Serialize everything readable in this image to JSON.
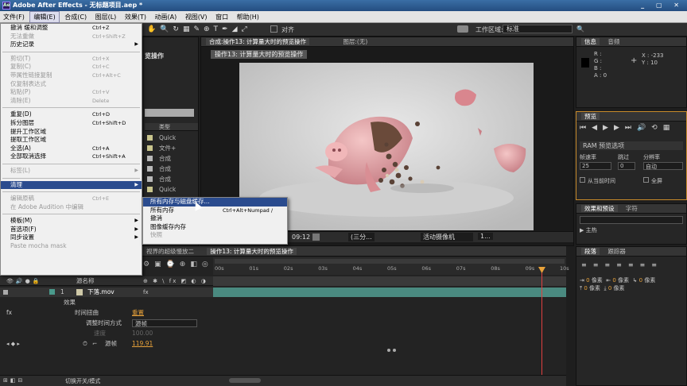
{
  "window": {
    "title": "Adobe After Effects - 无标题项目.aep *",
    "app_badge": "Ae"
  },
  "menubar": [
    "文件(F)",
    "编辑(E)",
    "合成(C)",
    "图层(L)",
    "效果(T)",
    "动画(A)",
    "视图(V)",
    "窗口",
    "帮助(H)"
  ],
  "edit_menu": [
    {
      "label": "撤消 缓和调整",
      "shortcut": "Ctrl+Z",
      "disabled": false
    },
    {
      "label": "无法重做",
      "shortcut": "Ctrl+Shift+Z",
      "disabled": true
    },
    {
      "label": "历史记录",
      "shortcut": "",
      "disabled": false,
      "submenu": true
    },
    {
      "sep": true
    },
    {
      "label": "剪切(T)",
      "shortcut": "Ctrl+X",
      "disabled": true
    },
    {
      "label": "复制(C)",
      "shortcut": "Ctrl+C",
      "disabled": true
    },
    {
      "label": "带属性链接复制",
      "shortcut": "Ctrl+Alt+C",
      "disabled": true
    },
    {
      "label": "仅复制表达式",
      "shortcut": "",
      "disabled": true
    },
    {
      "label": "粘贴(P)",
      "shortcut": "Ctrl+V",
      "disabled": true
    },
    {
      "label": "清除(E)",
      "shortcut": "Delete",
      "disabled": true
    },
    {
      "sep": true
    },
    {
      "label": "重复(D)",
      "shortcut": "Ctrl+D",
      "disabled": false
    },
    {
      "label": "拆分图层",
      "shortcut": "Ctrl+Shift+D",
      "disabled": false
    },
    {
      "label": "提升工作区域",
      "shortcut": "",
      "disabled": false
    },
    {
      "label": "提取工作区域",
      "shortcut": "",
      "disabled": false
    },
    {
      "label": "全选(A)",
      "shortcut": "Ctrl+A",
      "disabled": false
    },
    {
      "label": "全部取消选择",
      "shortcut": "Ctrl+Shift+A",
      "disabled": false
    },
    {
      "sep": true
    },
    {
      "label": "标签(L)",
      "shortcut": "",
      "disabled": true,
      "submenu": true
    },
    {
      "sep": true
    },
    {
      "label": "清理",
      "shortcut": "",
      "disabled": false,
      "submenu": true,
      "highlight": true
    },
    {
      "sep": true
    },
    {
      "label": "编辑原稿",
      "shortcut": "Ctrl+E",
      "disabled": true
    },
    {
      "label": "在 Adobe Audition 中编辑",
      "shortcut": "",
      "disabled": true
    },
    {
      "sep": true
    },
    {
      "label": "模板(M)",
      "shortcut": "",
      "disabled": false,
      "submenu": true
    },
    {
      "label": "首选项(F)",
      "shortcut": "",
      "disabled": false,
      "submenu": true
    },
    {
      "label": "同步设置",
      "shortcut": "",
      "disabled": false,
      "submenu": true
    },
    {
      "label": "Paste mocha mask",
      "shortcut": "",
      "disabled": true
    }
  ],
  "purge_submenu": [
    {
      "label": "所有内存与磁盘缓存...",
      "shortcut": "",
      "highlight": true
    },
    {
      "label": "所有内存",
      "shortcut": "Ctrl+Alt+Numpad /"
    },
    {
      "label": "撤消",
      "shortcut": ""
    },
    {
      "label": "图像缓存内存",
      "shortcut": ""
    },
    {
      "label": "快照",
      "shortcut": "",
      "disabled": true
    }
  ],
  "toolbar": {
    "snap_label": "对齐",
    "workspace_label": "工作区域:",
    "workspace_value": "标准"
  },
  "comp_panel": {
    "tab": "合成:操作13: 计算量大时的预览操作",
    "tab_layer": "图层:(无)",
    "breadcrumb": "操作13: 计算量大时的预览操作",
    "timecode": "09:12",
    "resolution": "(三分...",
    "camera": "活动摄像机",
    "views": "1..."
  },
  "project_panel": {
    "partial_title": "览操作",
    "col_type": "类型",
    "items": [
      {
        "type": "Quick"
      },
      {
        "type": "文件+"
      },
      {
        "type": "合成"
      },
      {
        "type": "合成"
      },
      {
        "type": "合成"
      },
      {
        "type": "Quick"
      }
    ]
  },
  "info_panel": {
    "tab_info": "信息",
    "tab_audio": "音频",
    "r": "R :",
    "g": "G :",
    "b": "B :",
    "a": "A : 0",
    "x": "X : -233",
    "y": "Y : 10"
  },
  "preview_panel": {
    "tab": "预览",
    "ram_options": "RAM 预览选项",
    "frame_rate_label": "帧速率",
    "skip_label": "跳过",
    "resolution_label": "分辨率",
    "frame_rate": "25",
    "skip": "0",
    "resolution": "自动",
    "from_current": "从当前时间",
    "fullscreen": "全屏"
  },
  "effects_panel": {
    "tab": "效果和预设",
    "tab2": "字符",
    "search_placeholder": "",
    "category": "▶ 主热"
  },
  "paragraph_panel": {
    "tab": "段落",
    "tab2": "跟踪器",
    "unit": "像素",
    "values": [
      "0",
      "0",
      "0",
      "0",
      "0"
    ]
  },
  "timeline": {
    "tabs": [
      "视界的超级慢放二",
      "操作13: 计算量大时的预览操作"
    ],
    "col_source": "源名称",
    "layer_num": "1",
    "layer_name": "下落.mov",
    "effects_label": "效果",
    "time_warp": "时间扭曲",
    "reset": "重置",
    "adjust_by": "调整时间方式",
    "adjust_value": "源帧",
    "speed_label": "速度",
    "speed_value": "100.00",
    "source_frame_label": "源帧",
    "source_frame_value": "119.91",
    "fx": "fx",
    "ruler": [
      "00s",
      "01s",
      "02s",
      "03s",
      "04s",
      "05s",
      "06s",
      "07s",
      "08s",
      "09s",
      "10s"
    ],
    "footer": "切换开关/模式"
  },
  "colors": {
    "accent": "#2a4b8e",
    "playhead": "#e8a23a",
    "teal": "#4a9a8c"
  }
}
